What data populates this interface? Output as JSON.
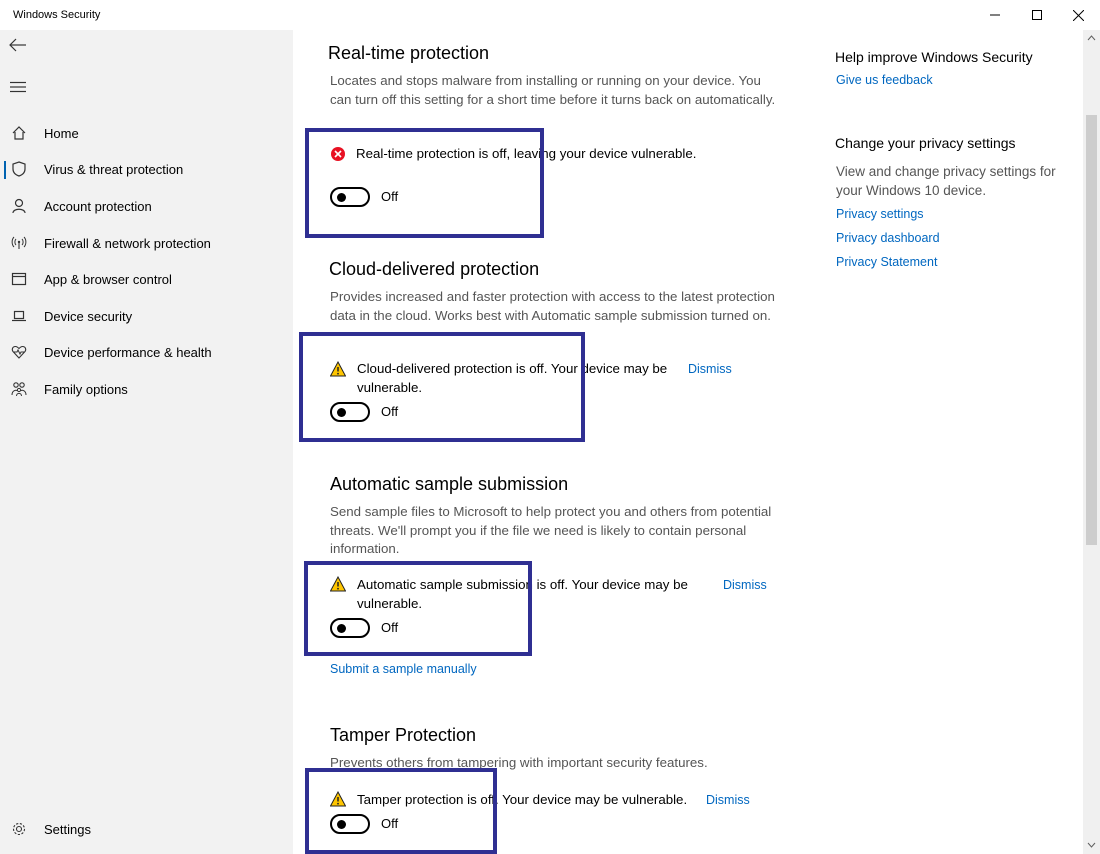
{
  "window": {
    "title": "Windows Security"
  },
  "sidebar": {
    "items": [
      {
        "label": "Home",
        "icon": "home-icon"
      },
      {
        "label": "Virus & threat protection",
        "icon": "shield-icon",
        "active": true
      },
      {
        "label": "Account protection",
        "icon": "person-icon"
      },
      {
        "label": "Firewall & network protection",
        "icon": "wifi-antenna-icon"
      },
      {
        "label": "App & browser control",
        "icon": "browser-window-icon"
      },
      {
        "label": "Device security",
        "icon": "laptop-icon"
      },
      {
        "label": "Device performance & health",
        "icon": "heart-pulse-icon"
      },
      {
        "label": "Family options",
        "icon": "family-icon"
      }
    ],
    "settings_label": "Settings"
  },
  "sections": {
    "realtime": {
      "title": "Real-time protection",
      "description": "Locates and stops malware from installing or running on your device. You can turn off this setting for a short time before it turns back on automatically.",
      "alert": "Real-time protection is off, leaving your device vulnerable.",
      "toggle_label": "Off"
    },
    "cloud": {
      "title": "Cloud-delivered protection",
      "description": "Provides increased and faster protection with access to the latest protection data in the cloud. Works best with Automatic sample submission turned on.",
      "alert": "Cloud-delivered protection is off. Your device may be vulnerable.",
      "dismiss": "Dismiss",
      "toggle_label": "Off"
    },
    "sample": {
      "title": "Automatic sample submission",
      "description": "Send sample files to Microsoft to help protect you and others from potential threats. We'll prompt you if the file we need is likely to contain personal information.",
      "alert": "Automatic sample submission is off. Your device may be vulnerable.",
      "dismiss": "Dismiss",
      "toggle_label": "Off",
      "submit_link": "Submit a sample manually"
    },
    "tamper": {
      "title": "Tamper Protection",
      "description": "Prevents others from tampering with important security features.",
      "alert": "Tamper protection is off. Your device may be vulnerable.",
      "dismiss": "Dismiss",
      "toggle_label": "Off"
    }
  },
  "right_panel": {
    "help_heading": "Help improve Windows Security",
    "feedback_link": "Give us feedback",
    "privacy_heading": "Change your privacy settings",
    "privacy_text": "View and change privacy settings for your Windows 10 device.",
    "links": [
      "Privacy settings",
      "Privacy dashboard",
      "Privacy Statement"
    ]
  },
  "colors": {
    "accent": "#0067c0",
    "highlight_border": "#2f2f92",
    "error_red": "#e81123",
    "warning_yellow": "#ffc600"
  }
}
